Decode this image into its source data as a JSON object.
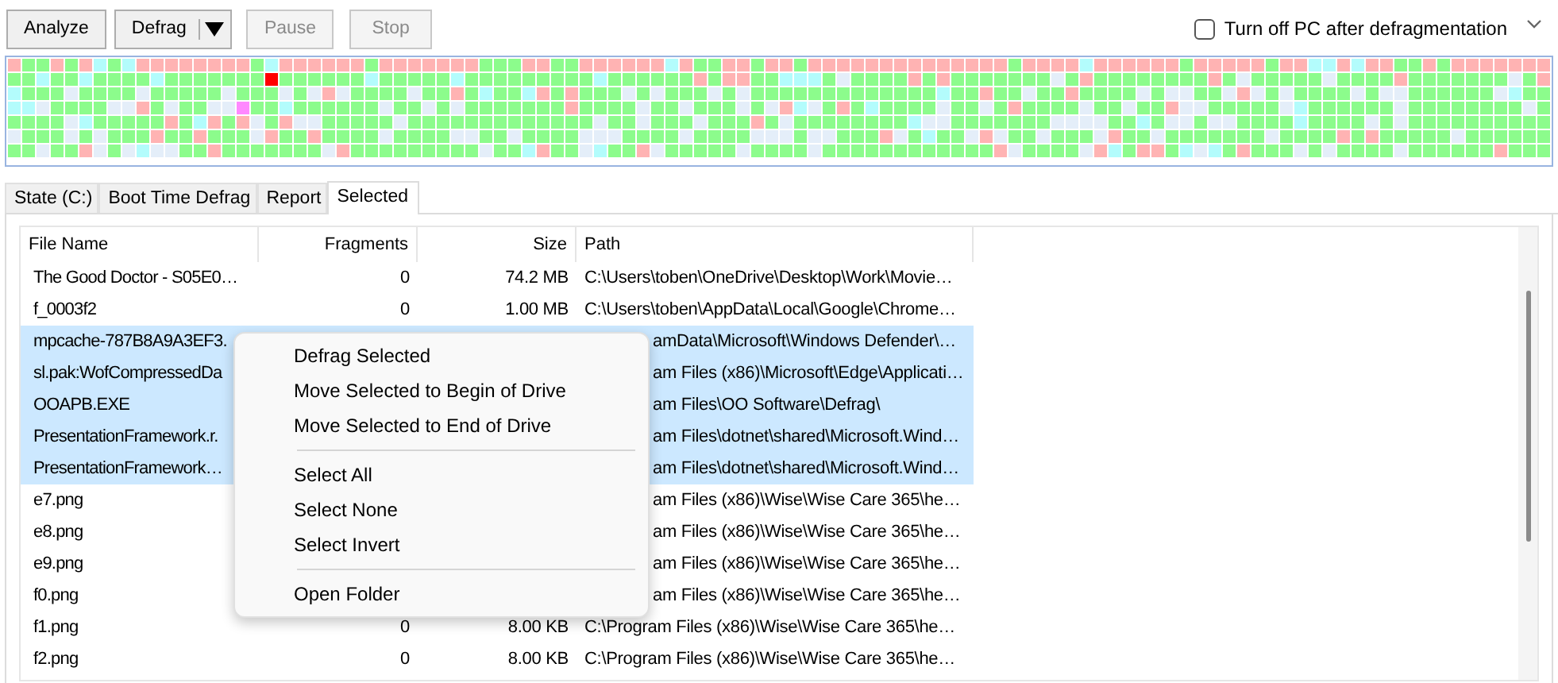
{
  "toolbar": {
    "buttons": [
      {
        "label": "Analyze",
        "kind": "plain",
        "disabled": false
      },
      {
        "label": "Defrag",
        "kind": "split",
        "disabled": false
      },
      {
        "label": "Pause",
        "kind": "plain",
        "disabled": true
      },
      {
        "label": "Stop",
        "kind": "plain",
        "disabled": true
      }
    ],
    "shutdown_option": {
      "label": "Turn off PC after defragmentation",
      "checked": false
    }
  },
  "tabs": [
    {
      "label": "State (C:)",
      "selected": false
    },
    {
      "label": "Boot Time Defrag",
      "selected": false
    },
    {
      "label": "Report",
      "selected": false
    },
    {
      "label": "Selected",
      "selected": true
    }
  ],
  "table": {
    "columns": [
      "File Name",
      "Fragments",
      "Size",
      "Path"
    ],
    "rows": [
      {
        "file_name": "The Good Doctor - S05E0…",
        "fragments": "0",
        "size": "74.2 MB",
        "path": "C:\\Users\\toben\\OneDrive\\Desktop\\Work\\Movie…",
        "selected": false
      },
      {
        "file_name": "f_0003f2",
        "fragments": "0",
        "size": "1.00 MB",
        "path": "C:\\Users\\toben\\AppData\\Local\\Google\\Chrome…",
        "selected": false
      },
      {
        "file_name": "mpcache-787B8A9A3EF3.",
        "path": "amData\\Microsoft\\Windows Defender\\…",
        "selected": true
      },
      {
        "file_name": "sl.pak:WofCompressedDa",
        "path": "am Files (x86)\\Microsoft\\Edge\\Applicati…",
        "selected": true
      },
      {
        "file_name": "OOAPB.EXE",
        "path": "am Files\\OO Software\\Defrag\\",
        "selected": true
      },
      {
        "file_name": "PresentationFramework.r.",
        "path": "am Files\\dotnet\\shared\\Microsoft.Wind…",
        "selected": true
      },
      {
        "file_name": "PresentationFramework…",
        "path": "am Files\\dotnet\\shared\\Microsoft.Wind…",
        "selected": true
      },
      {
        "file_name": "e7.png",
        "path": "am Files (x86)\\Wise\\Wise Care 365\\he…",
        "selected": false
      },
      {
        "file_name": "e8.png",
        "path": "am Files (x86)\\Wise\\Wise Care 365\\he…",
        "selected": false
      },
      {
        "file_name": "e9.png",
        "path": "am Files (x86)\\Wise\\Wise Care 365\\he…",
        "selected": false
      },
      {
        "file_name": "f0.png",
        "path": "am Files (x86)\\Wise\\Wise Care 365\\he…",
        "selected": false
      },
      {
        "file_name": "f1.png",
        "fragments": "0",
        "size": "8.00 KB",
        "path": "C:\\Program Files (x86)\\Wise\\Wise Care 365\\he…",
        "selected": false
      },
      {
        "file_name": "f2.png",
        "fragments": "0",
        "size": "8.00 KB",
        "path": "C:\\Program Files (x86)\\Wise\\Wise Care 365\\he…",
        "selected": false
      }
    ]
  },
  "context_menu": {
    "items": [
      {
        "kind": "item",
        "label": "Defrag Selected"
      },
      {
        "kind": "item",
        "label": "Move Selected to Begin of Drive"
      },
      {
        "kind": "item",
        "label": "Move Selected to End of Drive"
      },
      {
        "kind": "separator"
      },
      {
        "kind": "item",
        "label": "Select All"
      },
      {
        "kind": "item",
        "label": "Select None"
      },
      {
        "kind": "item",
        "label": "Select Invert"
      },
      {
        "kind": "separator"
      },
      {
        "kind": "item",
        "label": "Open Folder"
      }
    ]
  }
}
